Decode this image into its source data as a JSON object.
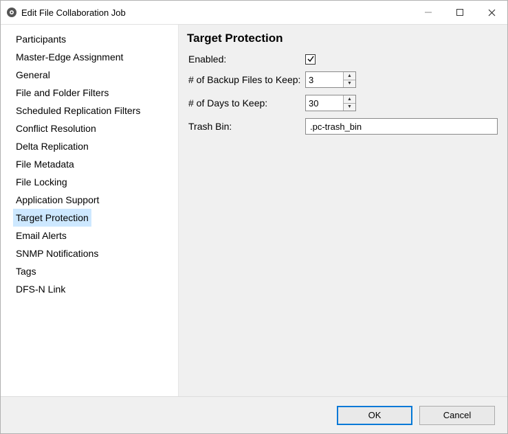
{
  "window": {
    "title": "Edit File Collaboration Job"
  },
  "sidebar": {
    "items": [
      {
        "label": "Participants"
      },
      {
        "label": "Master-Edge Assignment"
      },
      {
        "label": "General"
      },
      {
        "label": "File and Folder Filters"
      },
      {
        "label": "Scheduled Replication Filters"
      },
      {
        "label": "Conflict Resolution"
      },
      {
        "label": "Delta Replication"
      },
      {
        "label": "File Metadata"
      },
      {
        "label": "File Locking"
      },
      {
        "label": "Application Support"
      },
      {
        "label": "Target Protection",
        "selected": true
      },
      {
        "label": "Email Alerts"
      },
      {
        "label": "SNMP Notifications"
      },
      {
        "label": "Tags"
      },
      {
        "label": "DFS-N Link"
      }
    ]
  },
  "content": {
    "title": "Target Protection",
    "fields": {
      "enabled": {
        "label": "Enabled:",
        "checked": true
      },
      "backup_files": {
        "label": "# of Backup Files to Keep:",
        "value": "3"
      },
      "days_keep": {
        "label": "# of Days to Keep:",
        "value": "30"
      },
      "trash_bin": {
        "label": "Trash Bin:",
        "value": ".pc-trash_bin"
      }
    }
  },
  "footer": {
    "ok": "OK",
    "cancel": "Cancel"
  }
}
